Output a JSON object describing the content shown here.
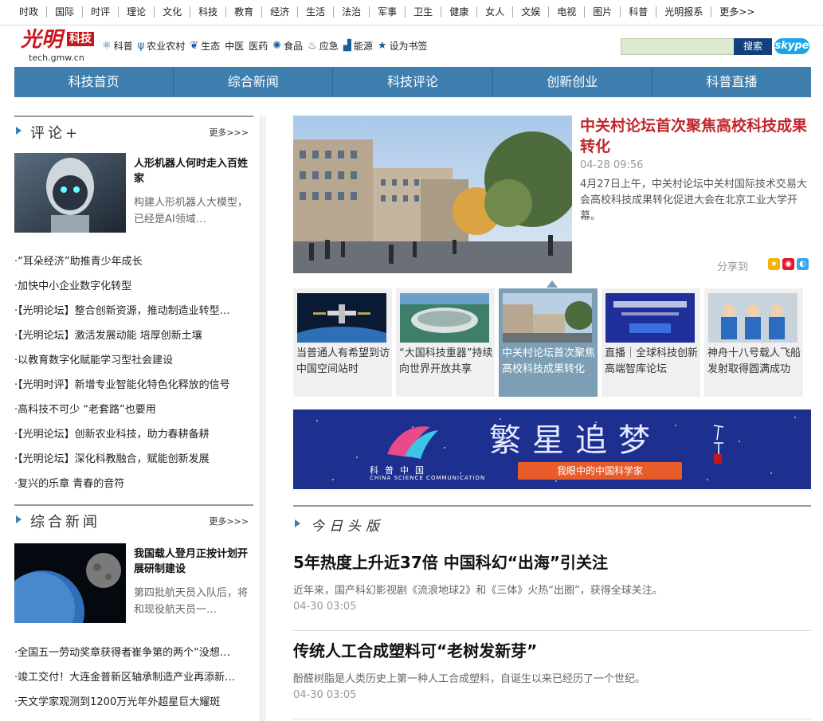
{
  "topnav": [
    "时政",
    "国际",
    "时评",
    "理论",
    "文化",
    "科技",
    "教育",
    "经济",
    "生活",
    "法治",
    "军事",
    "卫生",
    "健康",
    "女人",
    "文娱",
    "电视",
    "图片",
    "科普",
    "光明报系",
    "更多>>"
  ],
  "logo": {
    "brand": "光明",
    "tag": "科技",
    "domain": "tech.gmw.cn"
  },
  "catnav": [
    {
      "icon": "atom-icon",
      "glyph": "⚛",
      "label": "科普"
    },
    {
      "icon": "wheat-icon",
      "glyph": "ψ",
      "label": "农业农村"
    },
    {
      "icon": "leaf-icon",
      "glyph": "❦",
      "label": "生态"
    },
    {
      "icon": "",
      "glyph": "",
      "label": "中医"
    },
    {
      "icon": "",
      "glyph": "",
      "label": "医药"
    },
    {
      "icon": "gear-icon",
      "glyph": "✺",
      "label": "食品"
    },
    {
      "icon": "alarm-icon",
      "glyph": "♨",
      "label": "应急"
    },
    {
      "icon": "factory-icon",
      "glyph": "▟",
      "label": "能源"
    },
    {
      "icon": "star-icon",
      "glyph": "★",
      "label": "设为书签"
    }
  ],
  "search": {
    "button": "搜索",
    "skype": "skype"
  },
  "mainnav": [
    "科技首页",
    "综合新闻",
    "科技评论",
    "创新创业",
    "科普直播"
  ],
  "comment": {
    "title": "评论+",
    "more": "更多>>>",
    "feature": {
      "title": "人形机器人何时走入百姓家",
      "desc": "构建人形机器人大模型，已经是AI领域…"
    },
    "items": [
      "·“耳朵经济”助推青少年成长",
      "·加快中小企业数字化转型",
      "·【光明论坛】整合创新资源，推动制造业转型…",
      "·【光明论坛】激活发展动能 培厚创新土壤",
      "·以教育数字化赋能学习型社会建设",
      "·【光明时评】新增专业智能化特色化释放的信号",
      "·高科技不可少 “老套路”也要用",
      "·【光明论坛】创新农业科技，助力春耕备耕",
      "·【光明论坛】深化科教融合，赋能创新发展",
      "·复兴的乐章 青春的音符"
    ]
  },
  "general": {
    "title": "综合新闻",
    "more": "更多>>>",
    "feature": {
      "title": "我国载人登月正按计划开展研制建设",
      "desc": "第四批航天员入队后，将和现役航天员一…"
    },
    "items": [
      "·全国五一劳动奖章获得者崔争第的两个“没想…",
      "·竣工交付！大连金普新区轴承制造产业再添新…",
      "·天文学家观测到1200万光年外超星巨大耀斑"
    ]
  },
  "hero": {
    "title": "中关村论坛首次聚焦高校科技成果转化",
    "date": "04-28 09:56",
    "desc": "4月27日上午，中关村论坛中关村国际技术交易大会高校科技成果转化促进大会在北京工业大学开幕。",
    "share": "分享到"
  },
  "thumbs": [
    {
      "title": "当普通人有希望到访中国空间站时",
      "selected": false
    },
    {
      "title": "“大国科技重器”持续向世界开放共享",
      "selected": false
    },
    {
      "title": "中关村论坛首次聚焦高校科技成果转化",
      "selected": true
    },
    {
      "title": "直播｜全球科技创新高端智库论坛",
      "selected": false
    },
    {
      "title": "神舟十八号载人飞船发射取得圆满成功",
      "selected": false
    }
  ],
  "banner": {
    "logo_text": "科普中国",
    "logo_en": "CHINA SCIENCE COMMUNICATION",
    "headline": "繁星追梦",
    "sub": "我眼中的中国科学家"
  },
  "today": {
    "title": "今日头版",
    "news": [
      {
        "title": "5年热度上升近37倍 中国科幻“出海”引关注",
        "desc": "近年来，国产科幻影视剧《流浪地球2》和《三体》火热“出圈”，获得全球关注。",
        "date": "04-30 03:05"
      },
      {
        "title": "传统人工合成塑料可“老树发新芽”",
        "desc": "酚醛树脂是人类历史上第一种人工合成塑料，自诞生以来已经历了一个世纪。",
        "date": "04-30 03:05"
      }
    ]
  }
}
